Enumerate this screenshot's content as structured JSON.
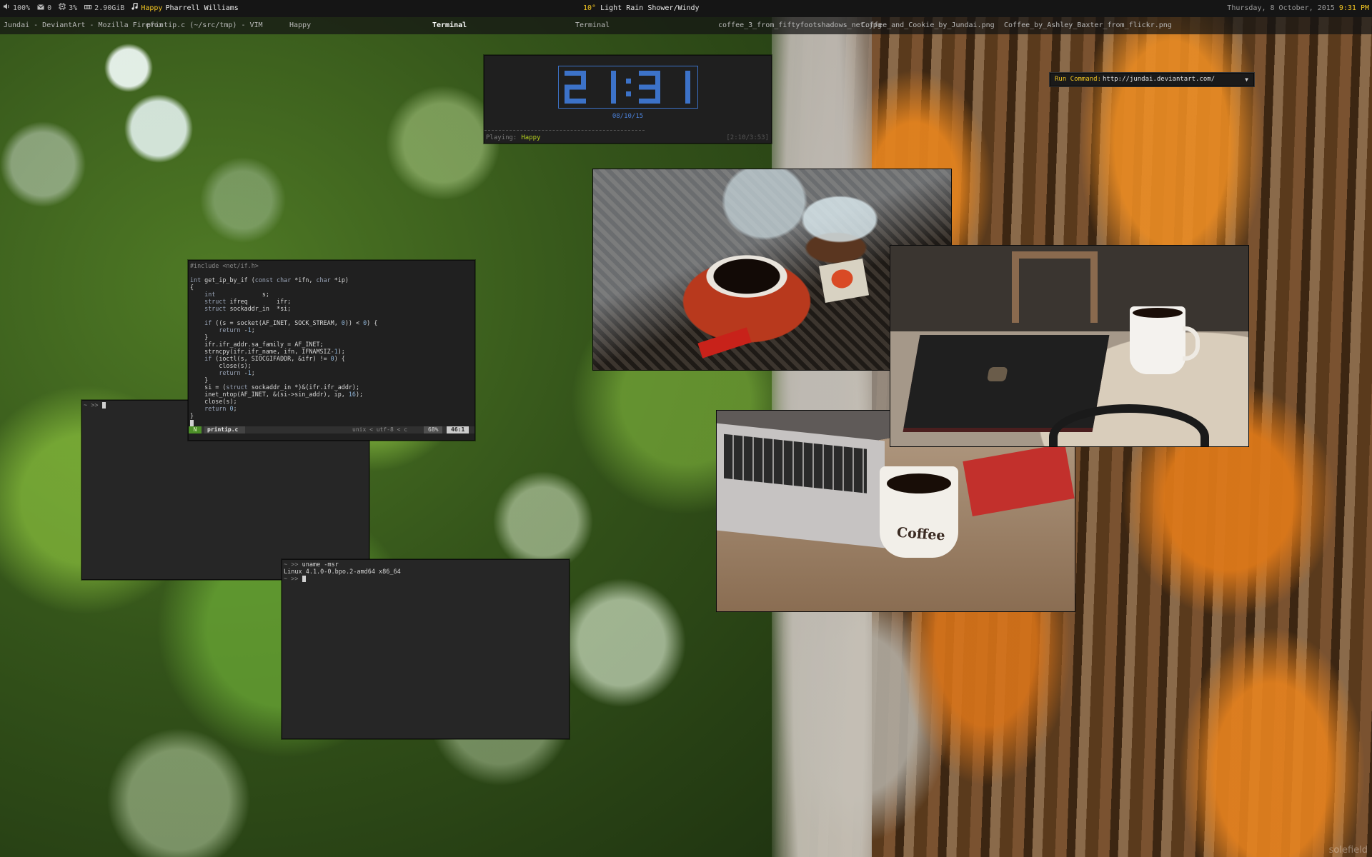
{
  "topbar": {
    "volume": "100%",
    "mail": "0",
    "cpu": "3%",
    "mem": "2.90GiB",
    "song_title": "Happy",
    "song_artist": "Pharrell Williams",
    "weather_temp": "10°",
    "weather_desc": "Light Rain Shower/Windy",
    "date": "Thursday, 8 October, 2015",
    "time": "9:31 PM"
  },
  "tasks": [
    "Jundai - DeviantArt - Mozilla Firefox",
    "printip.c (~/src/tmp) - VIM",
    "Happy",
    "Terminal",
    "Terminal",
    "coffee_3_from_fiftyfootshadows_net.jpg",
    "Coffee_and_Cookie_by_Jundai.png",
    "Coffee_by_Ashley_Baxter_from_flickr.png"
  ],
  "clock": {
    "digits": "21:31",
    "date": "08/10/15",
    "playing_label": "Playing:",
    "song": "Happy",
    "elapsed": "[2:10/3:53]"
  },
  "run_command": {
    "label": "Run Command:",
    "value": "http://jundai.deviantart.com/"
  },
  "vim": {
    "lines": [
      "#include <net/if.h>",
      "",
      "int get_ip_by_if (const char *ifn, char *ip)",
      "{",
      "    int             s;",
      "    struct ifreq        ifr;",
      "    struct sockaddr_in  *si;",
      "",
      "    if ((s = socket(AF_INET, SOCK_STREAM, 0)) < 0) {",
      "        return -1;",
      "    }",
      "    ifr.ifr_addr.sa_family = AF_INET;",
      "    strncpy(ifr.ifr_name, ifn, IFNAMSIZ-1);",
      "    if (ioctl(s, SIOCGIFADDR, &ifr) != 0) {",
      "        close(s);",
      "        return -1;",
      "    }",
      "    si = (struct sockaddr_in *)&(ifr.ifr_addr);",
      "    inet_ntop(AF_INET, &(si->sin_addr), ip, 16);",
      "    close(s);",
      "    return 0;",
      "}"
    ],
    "mode": "N",
    "filename": "printip.c",
    "file_info": "unix < utf-8 < c",
    "percent": "68%",
    "position": "46:1"
  },
  "terminal_a": {
    "prompt": "~ >> "
  },
  "terminal_b": {
    "prompt1": "~ >> ",
    "command": "uname -msr",
    "output": "Linux 4.1.0-0.bpo.2-amd64 x86_64",
    "prompt2": "~ >> "
  },
  "images": {
    "mug_text": "Coffee"
  },
  "watermark": "solefield",
  "colors": {
    "accent_yellow": "#f3c622",
    "clock_blue": "#3c72c8",
    "vim_mode_green": "#4c8f28",
    "song_green": "#b6d11f"
  },
  "icons": {
    "volume": "speaker-icon",
    "mail": "envelope-icon",
    "cpu": "cpu-icon",
    "mem": "memory-icon",
    "music": "music-note-icon",
    "dropdown": "chevron-down-icon"
  }
}
